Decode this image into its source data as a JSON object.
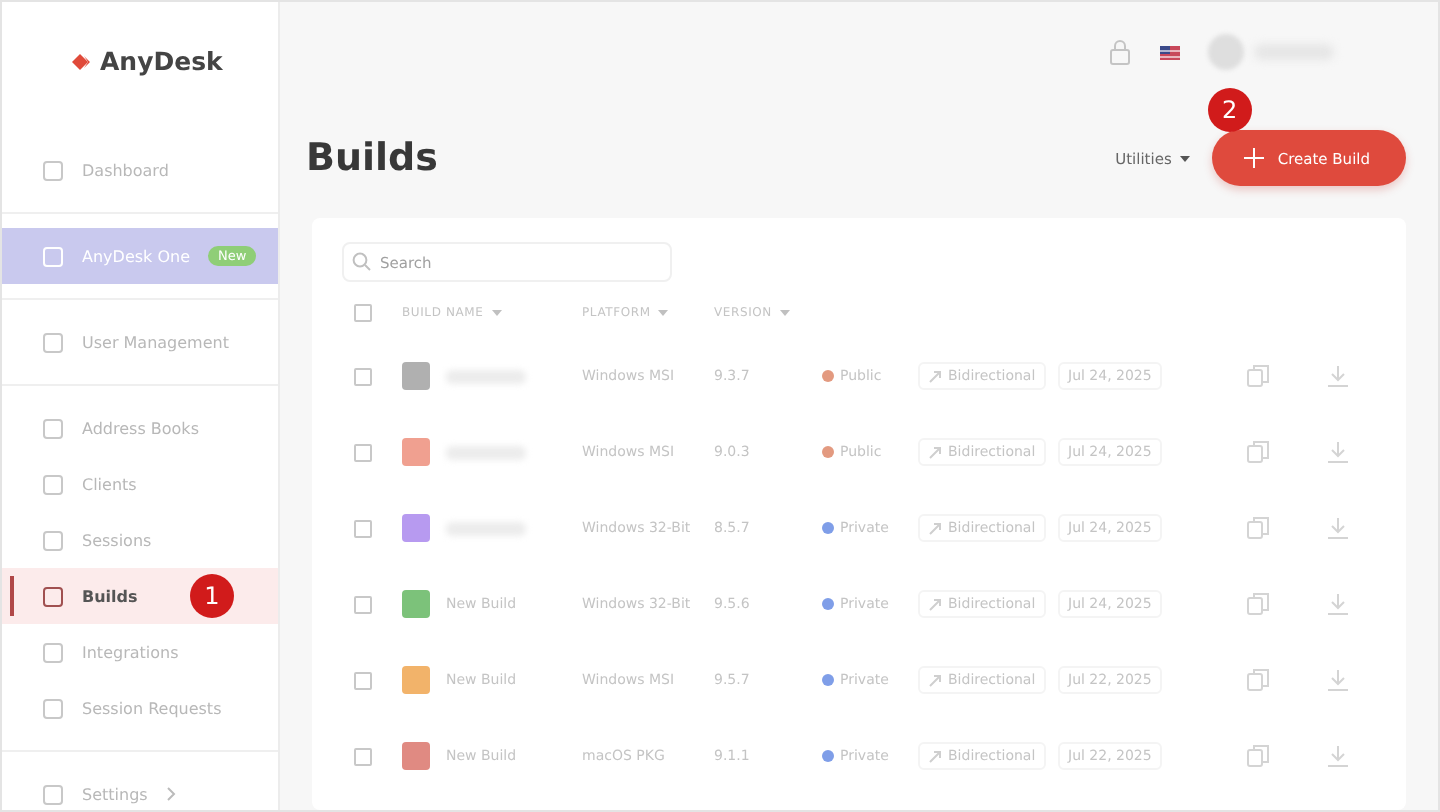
{
  "logo": {
    "text": "AnyDesk"
  },
  "sidebar": {
    "sections": [
      {
        "items": [
          {
            "label": "Dashboard",
            "kind": "link",
            "selected": false
          }
        ]
      },
      {
        "items": [
          {
            "label": "AnyDesk One",
            "kind": "promo",
            "badge": "New",
            "selected": false
          }
        ]
      },
      {
        "items": [
          {
            "label": "User Management",
            "kind": "link",
            "selected": false
          }
        ]
      },
      {
        "items": [
          {
            "label": "Address Books",
            "kind": "link",
            "selected": false
          },
          {
            "label": "Clients",
            "kind": "link",
            "selected": false
          },
          {
            "label": "Sessions",
            "kind": "link",
            "selected": false
          },
          {
            "label": "Builds",
            "kind": "link",
            "selected": true,
            "marker": "1"
          },
          {
            "label": "Integrations",
            "kind": "link",
            "selected": false
          },
          {
            "label": "Session Requests",
            "kind": "link",
            "selected": false
          }
        ]
      },
      {
        "items": [
          {
            "label": "Settings",
            "kind": "submenu",
            "selected": false
          }
        ]
      }
    ]
  },
  "page": {
    "title": "Builds",
    "utilities": "Utilities",
    "create_button": {
      "label": "Create Build",
      "marker": "2"
    }
  },
  "table": {
    "search": {
      "placeholder": "Search"
    },
    "select_all": {
      "checked": false
    },
    "columns": [
      "BUILD NAME",
      "PLATFORM",
      "VERSION"
    ],
    "rows": [
      {
        "checked": false,
        "color": "#b0b0b0",
        "platform": "Windows MSI",
        "version": "9.3.7",
        "visibility": {
          "label": "Public",
          "color": "#e39a80"
        },
        "direction": "Bidirectional",
        "date": "Jul 24, 2025"
      },
      {
        "checked": false,
        "color": "#f0a090",
        "platform": "Windows MSI",
        "version": "9.0.3",
        "visibility": {
          "label": "Public",
          "color": "#e39a80"
        },
        "direction": "Bidirectional",
        "date": "Jul 24, 2025"
      },
      {
        "checked": false,
        "color": "#b79af0",
        "platform": "Windows 32-Bit",
        "version": "8.5.7",
        "visibility": {
          "label": "Private",
          "color": "#7f9ee8"
        },
        "direction": "Bidirectional",
        "date": "Jul 24, 2025"
      },
      {
        "checked": false,
        "color": "#7cc27a",
        "name": "New Build",
        "platform": "Windows 32-Bit",
        "version": "9.5.6",
        "visibility": {
          "label": "Private",
          "color": "#7f9ee8"
        },
        "direction": "Bidirectional",
        "date": "Jul 24, 2025"
      },
      {
        "checked": false,
        "color": "#f2b36a",
        "name": "New Build",
        "platform": "Windows MSI",
        "version": "9.5.7",
        "visibility": {
          "label": "Private",
          "color": "#7f9ee8"
        },
        "direction": "Bidirectional",
        "date": "Jul 22, 2025"
      },
      {
        "checked": false,
        "color": "#e08a82",
        "name": "New Build",
        "platform": "macOS PKG",
        "version": "9.1.1",
        "visibility": {
          "label": "Private",
          "color": "#7f9ee8"
        },
        "direction": "Bidirectional",
        "date": "Jul 22, 2025"
      }
    ]
  }
}
